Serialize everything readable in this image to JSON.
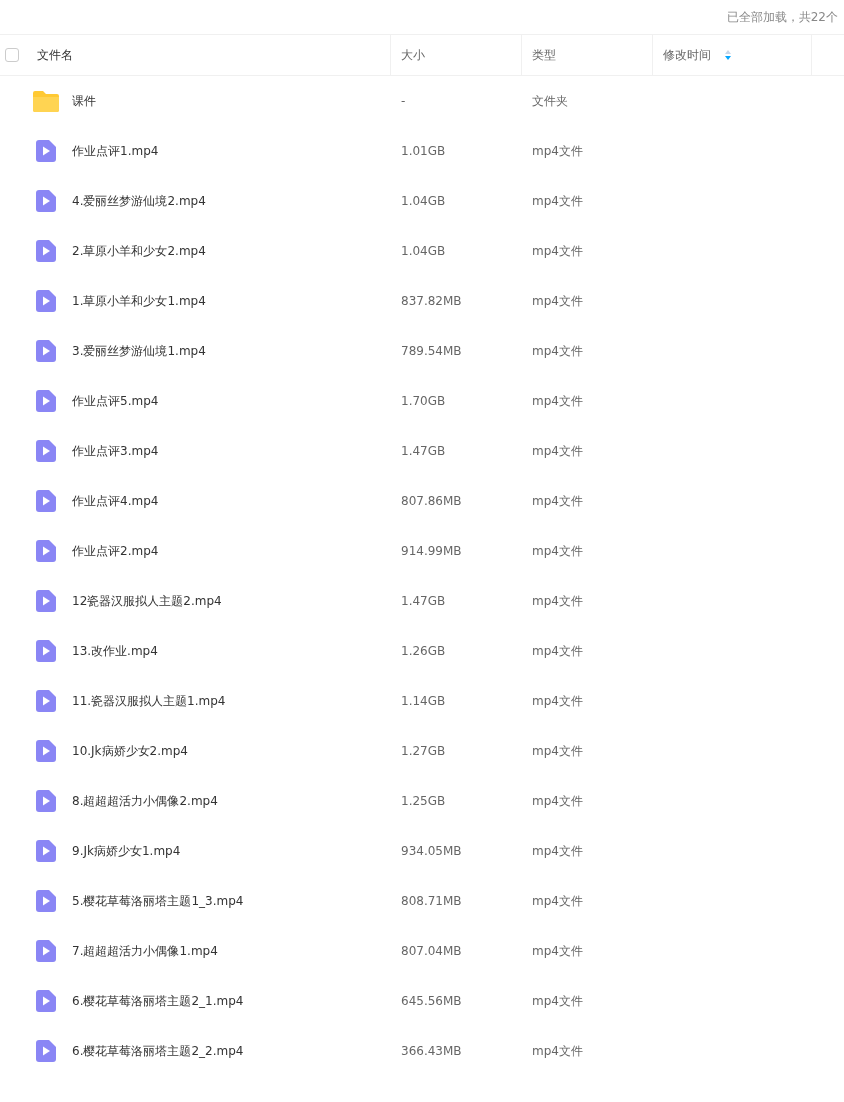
{
  "load_status": "已全部加载，共22个",
  "table": {
    "select_all": {
      "checked": false
    },
    "columns": [
      {
        "label": "文件名",
        "sortable": false
      },
      {
        "label": "大小",
        "sortable": false
      },
      {
        "label": "类型",
        "sortable": false
      },
      {
        "label": "修改时间",
        "sortable": true
      }
    ],
    "rows": [
      {
        "kind": "folder",
        "name": "课件",
        "size": "-",
        "type": "文件夹"
      },
      {
        "kind": "video",
        "name": "作业点评1.mp4",
        "size": "1.01GB",
        "type": "mp4文件"
      },
      {
        "kind": "video",
        "name": "4.爱丽丝梦游仙境2.mp4",
        "size": "1.04GB",
        "type": "mp4文件"
      },
      {
        "kind": "video",
        "name": "2.草原小羊和少女2.mp4",
        "size": "1.04GB",
        "type": "mp4文件"
      },
      {
        "kind": "video",
        "name": "1.草原小羊和少女1.mp4",
        "size": "837.82MB",
        "type": "mp4文件"
      },
      {
        "kind": "video",
        "name": "3.爱丽丝梦游仙境1.mp4",
        "size": "789.54MB",
        "type": "mp4文件"
      },
      {
        "kind": "video",
        "name": "作业点评5.mp4",
        "size": "1.70GB",
        "type": "mp4文件"
      },
      {
        "kind": "video",
        "name": "作业点评3.mp4",
        "size": "1.47GB",
        "type": "mp4文件"
      },
      {
        "kind": "video",
        "name": "作业点评4.mp4",
        "size": "807.86MB",
        "type": "mp4文件"
      },
      {
        "kind": "video",
        "name": "作业点评2.mp4",
        "size": "914.99MB",
        "type": "mp4文件"
      },
      {
        "kind": "video",
        "name": "12瓷器汉服拟人主题2.mp4",
        "size": "1.47GB",
        "type": "mp4文件"
      },
      {
        "kind": "video",
        "name": "13.改作业.mp4",
        "size": "1.26GB",
        "type": "mp4文件"
      },
      {
        "kind": "video",
        "name": "11.瓷器汉服拟人主题1.mp4",
        "size": "1.14GB",
        "type": "mp4文件"
      },
      {
        "kind": "video",
        "name": "10.Jk病娇少女2.mp4",
        "size": "1.27GB",
        "type": "mp4文件"
      },
      {
        "kind": "video",
        "name": "8.超超超活力小偶像2.mp4",
        "size": "1.25GB",
        "type": "mp4文件"
      },
      {
        "kind": "video",
        "name": "9.Jk病娇少女1.mp4",
        "size": "934.05MB",
        "type": "mp4文件"
      },
      {
        "kind": "video",
        "name": "5.樱花草莓洛丽塔主题1_3.mp4",
        "size": "808.71MB",
        "type": "mp4文件"
      },
      {
        "kind": "video",
        "name": "7.超超超活力小偶像1.mp4",
        "size": "807.04MB",
        "type": "mp4文件"
      },
      {
        "kind": "video",
        "name": "6.樱花草莓洛丽塔主题2_1.mp4",
        "size": "645.56MB",
        "type": "mp4文件"
      },
      {
        "kind": "video",
        "name": "6.樱花草莓洛丽塔主题2_2.mp4",
        "size": "366.43MB",
        "type": "mp4文件"
      }
    ]
  }
}
